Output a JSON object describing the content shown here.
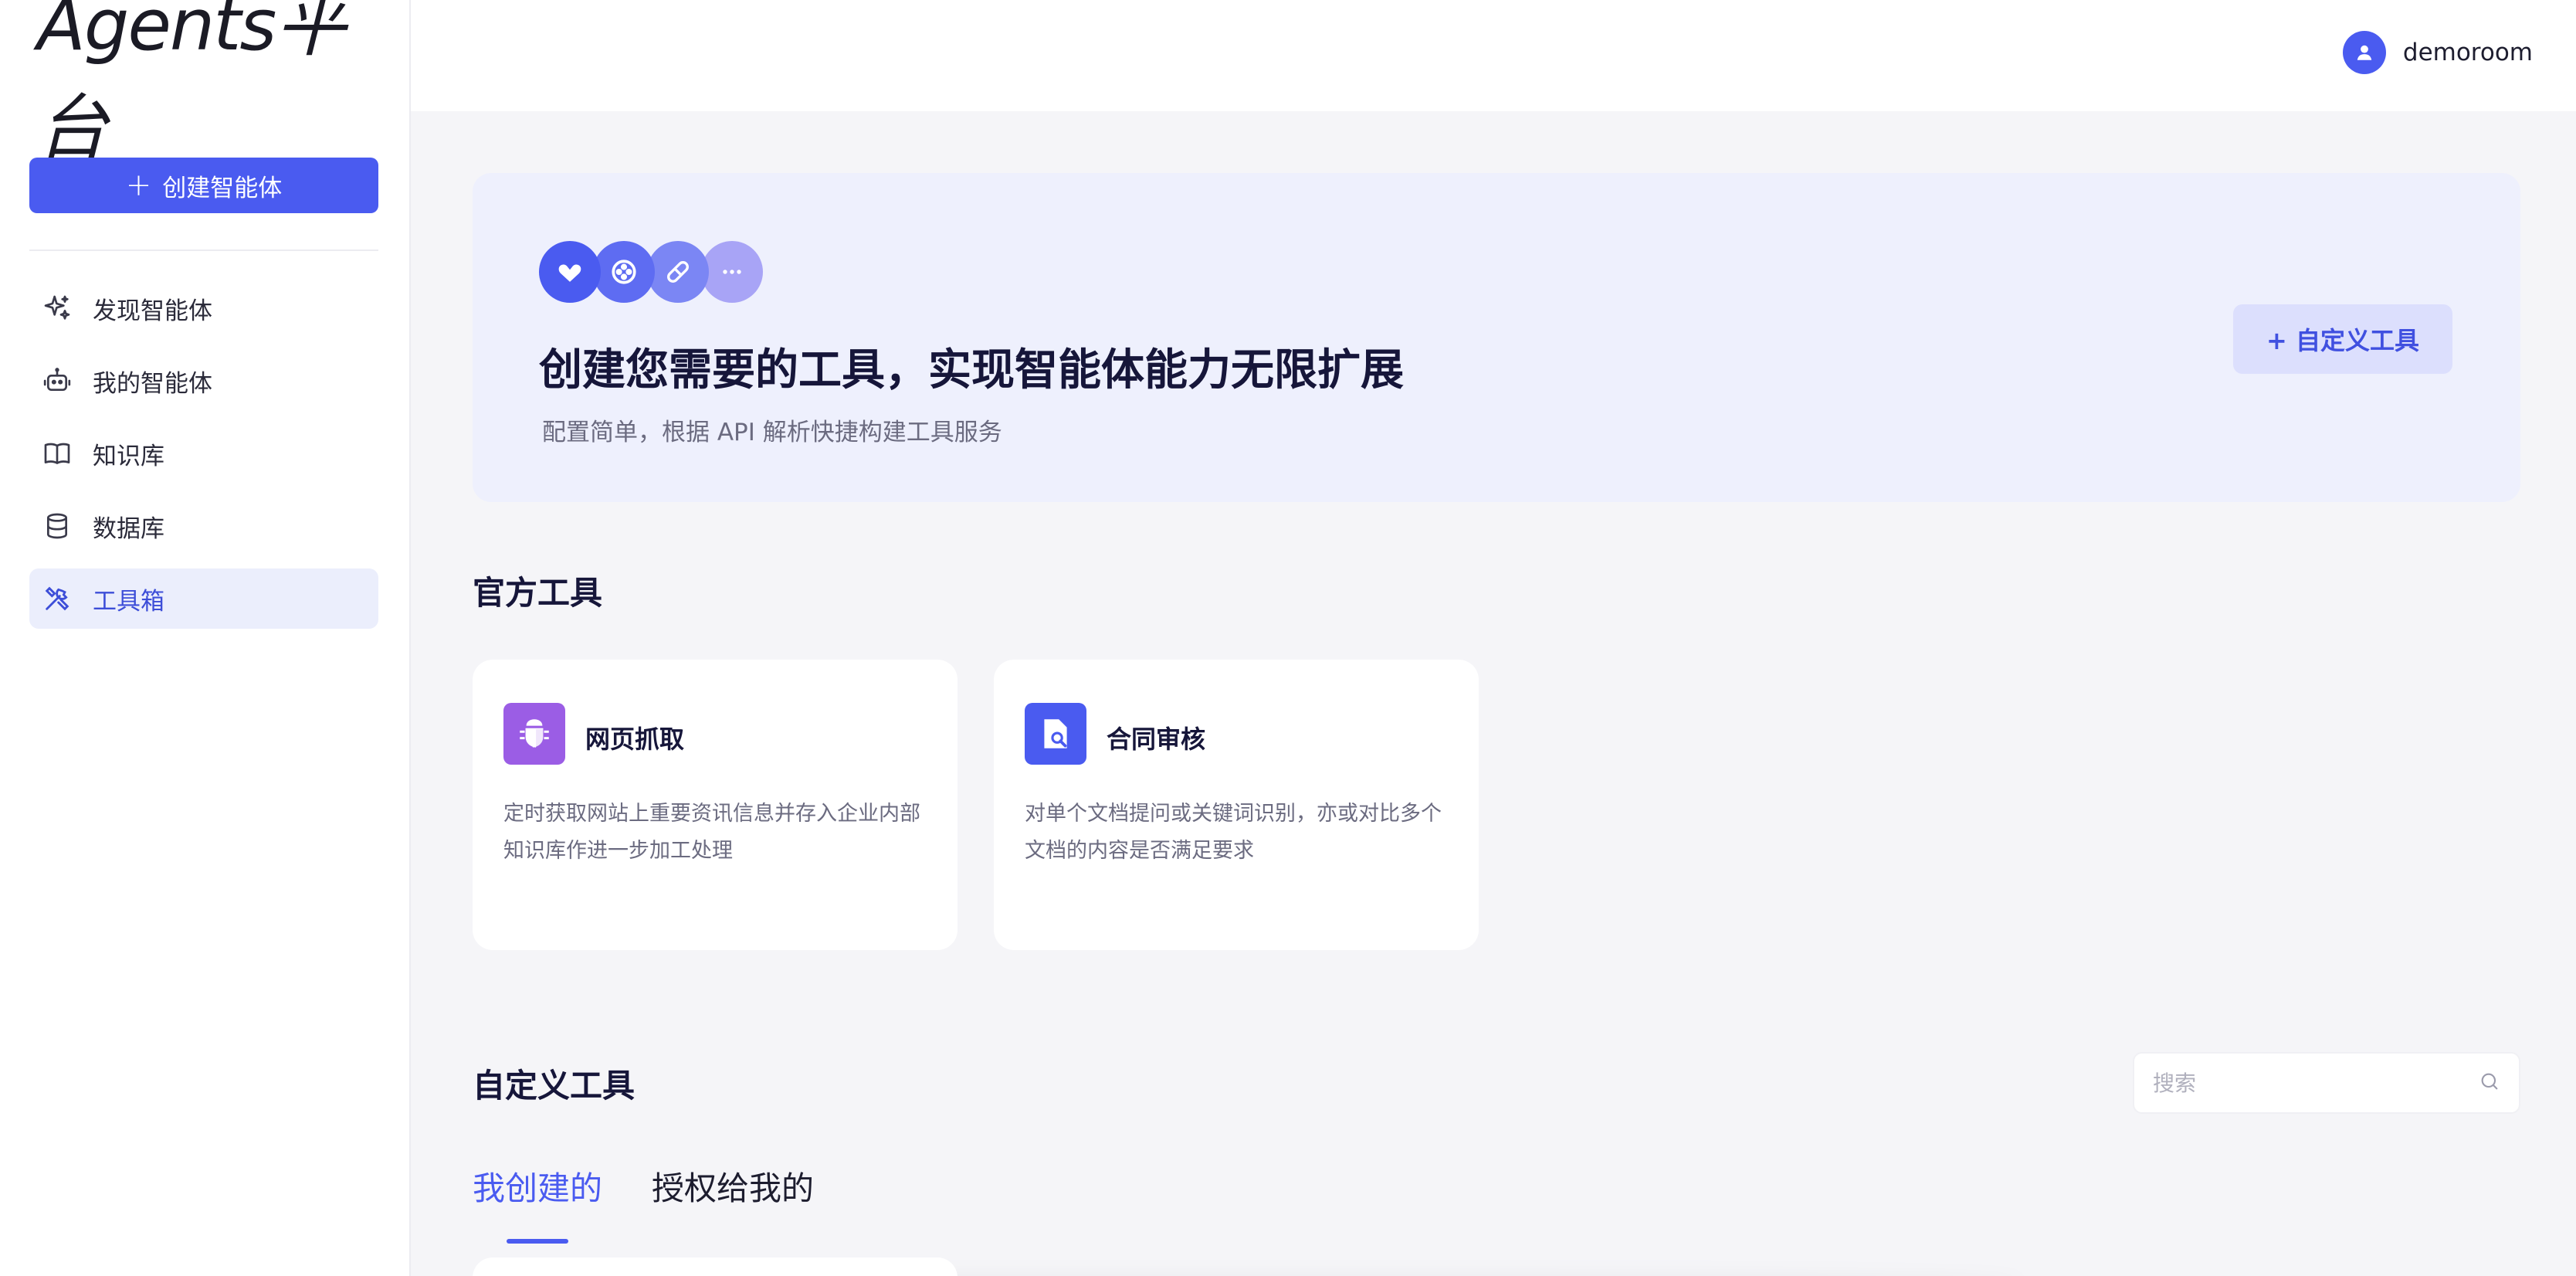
{
  "brand": {
    "logo_text": "Agents平台"
  },
  "sidebar": {
    "create_button": {
      "icon": "plus",
      "label": "创建智能体"
    },
    "items": [
      {
        "icon": "sparkle-icon",
        "label": "发现智能体",
        "active": false
      },
      {
        "icon": "robot-icon",
        "label": "我的智能体",
        "active": false
      },
      {
        "icon": "book-icon",
        "label": "知识库",
        "active": false
      },
      {
        "icon": "database-icon",
        "label": "数据库",
        "active": false
      },
      {
        "icon": "tools-icon",
        "label": "工具箱",
        "active": true
      }
    ]
  },
  "header": {
    "username": "demoroom"
  },
  "hero": {
    "icons": [
      "heart-hand-icon",
      "game-icon",
      "pill-icon",
      "more-icon"
    ],
    "title": "创建您需要的工具，实现智能体能力无限扩展",
    "subtitle": "配置简单，根据 API 解析快捷构建工具服务",
    "button_label": "+ 自定义工具"
  },
  "official_tools": {
    "title": "官方工具",
    "cards": [
      {
        "icon": "spider-icon",
        "title": "网页抓取",
        "description": "定时获取网站上重要资讯信息并存入企业内部知识库作进一步加工处理"
      },
      {
        "icon": "document-search-icon",
        "title": "合同审核",
        "description": "对单个文档提问或关键词识别，亦或对比多个文档的内容是否满足要求"
      }
    ]
  },
  "custom_tools": {
    "title": "自定义工具",
    "search_placeholder": "搜索",
    "tabs": [
      {
        "label": "我创建的",
        "active": true
      },
      {
        "label": "授权给我的",
        "active": false
      }
    ]
  },
  "colors": {
    "accent": "#4a5bf0",
    "hero_bg": "#eef0fd",
    "page_bg": "#f5f5f8",
    "spider_icon_bg": "#9b5de5",
    "doc_icon_bg": "#4a5bf0"
  }
}
